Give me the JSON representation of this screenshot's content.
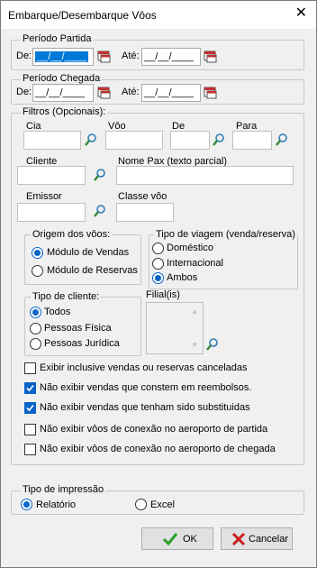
{
  "window": {
    "title": "Embarque/Desembarque Vôos"
  },
  "periodo_partida": {
    "legend": "Período Partida",
    "de_label": "De:",
    "de_value": "__/__/____",
    "ate_label": "Até:",
    "ate_value": "__/__/____"
  },
  "periodo_chegada": {
    "legend": "Período Chegada",
    "de_label": "De:",
    "de_value": "__/__/____",
    "ate_label": "Até:",
    "ate_value": "__/__/____"
  },
  "filtros": {
    "legend": "Filtros (Opcionais):",
    "cia": "Cia",
    "voo": "Vôo",
    "de": "De",
    "para": "Para",
    "cliente": "Cliente",
    "nome_pax": "Nome Pax (texto parcial)",
    "emissor": "Emissor",
    "classe_voo": "Classe vôo"
  },
  "origem": {
    "legend": "Origem dos vôos:",
    "options": [
      "Módulo de Vendas",
      "Módulo de Reservas"
    ],
    "selected": "Módulo de Vendas"
  },
  "tipo_viagem": {
    "legend": "Tipo de viagem (venda/reserva)",
    "options": [
      "Doméstico",
      "Internacional",
      "Ambos"
    ],
    "selected": "Ambos"
  },
  "tipo_cliente": {
    "legend": "Tipo de cliente:",
    "options": [
      "Todos",
      "Pessoas Física",
      "Pessoas Jurídica"
    ],
    "selected": "Todos"
  },
  "filial": {
    "label": "Filial(is)"
  },
  "checks": [
    {
      "label": "Exibir inclusive vendas ou reservas canceladas",
      "checked": false
    },
    {
      "label": "Não exibir vendas que constem em reembolsos.",
      "checked": true
    },
    {
      "label": "Não exibir vendas que tenham sido substituidas",
      "checked": true
    },
    {
      "label": "Não exibir vôos de conexão no aeroporto de partida",
      "checked": false
    },
    {
      "label": "Não exibir vôos de conexão no aeroporto de chegada",
      "checked": false
    }
  ],
  "tipo_impressao": {
    "legend": "Tipo de impressão",
    "options": [
      "Relatório",
      "Excel"
    ],
    "selected": "Relatório"
  },
  "buttons": {
    "ok": "OK",
    "cancel": "Cancelar"
  },
  "colors": {
    "accent": "#0a64c8",
    "ok_icon": "#2aa12a",
    "cancel_icon": "#c81e1e"
  },
  "icons": {
    "calendar": "calendar-icon",
    "search": "search-person-icon",
    "ok": "check-icon",
    "cancel": "x-icon"
  }
}
